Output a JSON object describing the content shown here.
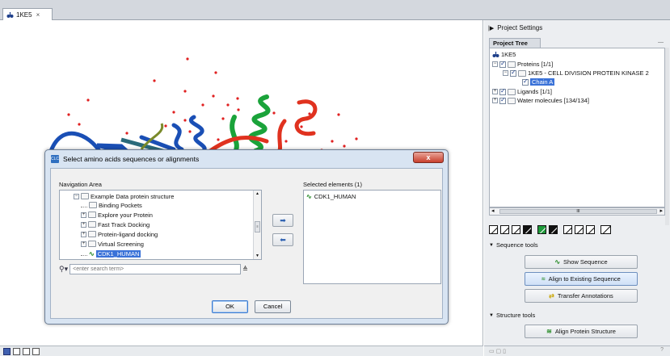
{
  "editor_tab": {
    "label": "1KE5",
    "close": "×"
  },
  "side_panel": {
    "header": "Project Settings",
    "tree_tab": "Project Tree",
    "tree": {
      "root": "1KE5",
      "proteins": "Proteins [1/1]",
      "protein_entry": "1KE5 - CELL DIVISION PROTEIN KINASE 2",
      "chain": "Chain A",
      "ligands": "Ligands [1/1]",
      "water": "Water molecules [134/134]"
    },
    "scroll_mid": "III",
    "sequence_tools": {
      "label": "Sequence tools",
      "show_sequence": "Show Sequence",
      "align_existing": "Align to Existing Sequence",
      "transfer_annotations": "Transfer Annotations"
    },
    "structure_tools": {
      "label": "Structure tools",
      "align_structure": "Align Protein Structure"
    },
    "help": "?"
  },
  "dialog": {
    "title": "Select amino acids sequences or alignments",
    "close": "x",
    "navigation_area_label": "Navigation Area",
    "nav_items": [
      "Example Data protein structure",
      "Binding Pockets",
      "Explore your Protein",
      "Fast Track Docking",
      "Protein-ligand docking",
      "Virtual Screening",
      "CDK1_HUMAN"
    ],
    "selected_label": "Selected elements (1)",
    "selected_items": [
      "CDK1_HUMAN"
    ],
    "move_right": "➡",
    "move_left": "⬅",
    "search_placeholder": "<enter search term>",
    "ok": "OK",
    "cancel": "Cancel"
  },
  "colors": {
    "helix_blue": "#1a4fb5",
    "helix_green": "#1aa33a",
    "helix_red": "#e0321f",
    "water_red": "#e02020",
    "selection_blue": "#3a72d8"
  }
}
